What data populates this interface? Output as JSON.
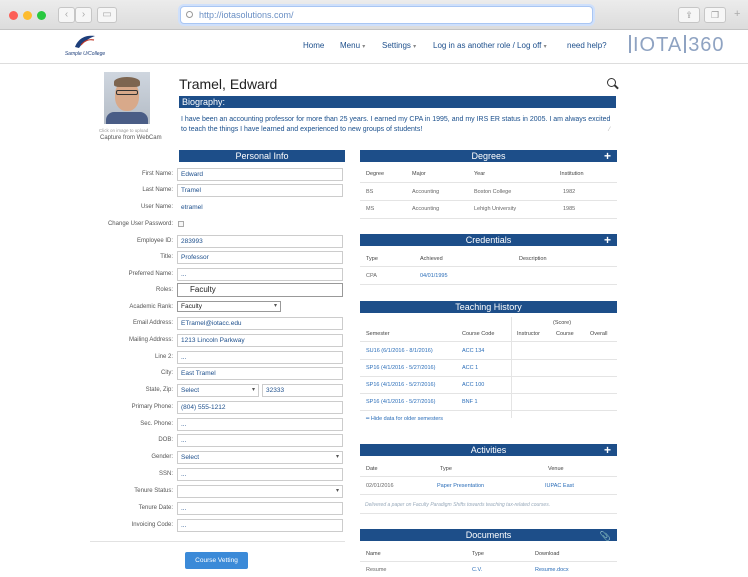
{
  "browser": {
    "url": "http://iotasolutions.com/"
  },
  "header": {
    "logo_text": "Sample U/College",
    "nav": {
      "home": "Home",
      "menu": "Menu",
      "settings": "Settings",
      "login_as": "Log in as another role / Log off",
      "help": "need help?"
    },
    "brand_left": "IOTA",
    "brand_right": "360"
  },
  "profile": {
    "name": "Tramel, Edward",
    "photo_caption": "Click on image to upload",
    "capture": "Capture from WebCam",
    "bio_title": "Biography:",
    "bio_text": "I have been an accounting professor for more than 25 years.  I earned my CPA in 1995, and my IRS ER status in 2005.  I am always excited to teach the things I have learned and experienced to new groups of students!"
  },
  "personal": {
    "title": "Personal Info",
    "fields": {
      "first_name": {
        "label": "First Name:",
        "value": "Edward"
      },
      "last_name": {
        "label": "Last Name:",
        "value": "Tramel"
      },
      "user_name": {
        "label": "User Name:",
        "value": "etramel"
      },
      "change_pw": {
        "label": "Change User Password:"
      },
      "employee_id": {
        "label": "Employee ID:",
        "value": "283993"
      },
      "title": {
        "label": "Title:",
        "value": "Professor"
      },
      "preferred": {
        "label": "Preferred Name:",
        "value": "..."
      },
      "roles": {
        "label": "Roles:",
        "value": "Faculty"
      },
      "rank": {
        "label": "Academic Rank:",
        "value": "Faculty"
      },
      "email": {
        "label": "Email Address:",
        "value": "ETramel@iotacc.edu"
      },
      "mailing": {
        "label": "Mailing Address:",
        "value": "1213 Lincoln Parkway"
      },
      "line2": {
        "label": "Line 2:",
        "value": "..."
      },
      "city": {
        "label": "City:",
        "value": "East Tramel"
      },
      "state_zip": {
        "label": "State, Zip:",
        "state": "Select",
        "zip": "32333"
      },
      "phone": {
        "label": "Primary Phone:",
        "value": "(804) 555-1212"
      },
      "sec_phone": {
        "label": "Sec. Phone:",
        "value": "..."
      },
      "dob": {
        "label": "DOB:",
        "value": "..."
      },
      "gender": {
        "label": "Gender:",
        "value": "Select"
      },
      "ssn": {
        "label": "SSN:",
        "value": "..."
      },
      "tenure_status": {
        "label": "Tenure Status:",
        "value": ""
      },
      "tenure_date": {
        "label": "Tenure Date:",
        "value": "..."
      },
      "invoicing": {
        "label": "Invoicing Code:",
        "value": "..."
      }
    },
    "vetting_button": "Course Vetting"
  },
  "degrees": {
    "title": "Degrees",
    "headers": [
      "Degree",
      "Major",
      "Year",
      "Institution"
    ],
    "rows": [
      [
        "BS",
        "Accounting",
        "Boston College",
        "1982"
      ],
      [
        "MS",
        "Accounting",
        "Lehigh University",
        "1985"
      ]
    ]
  },
  "credentials": {
    "title": "Credentials",
    "headers": [
      "Type",
      "Achieved",
      "Description"
    ],
    "rows": [
      [
        "CPA",
        "04/01/1995",
        ""
      ]
    ]
  },
  "teaching": {
    "title": "Teaching History",
    "score_label": "(Score)",
    "headers": [
      "Semester",
      "Course Code",
      "Instructor",
      "Course",
      "Overall"
    ],
    "rows": [
      [
        "SU16 (6/1/2016 - 8/1/2016)",
        "ACC 134"
      ],
      [
        "SP16 (4/1/2016 - 5/27/2016)",
        "ACC 1"
      ],
      [
        "SP16 (4/1/2016 - 5/27/2016)",
        "ACC 100"
      ],
      [
        "SP16 (4/1/2016 - 5/27/2016)",
        "BNF 1"
      ]
    ],
    "hide_link": "Hide data for older semesters"
  },
  "activities": {
    "title": "Activities",
    "headers": [
      "Date",
      "Type",
      "Venue"
    ],
    "rows": [
      [
        "02/01/2016",
        "Paper Presentation",
        "IUPAC East"
      ]
    ],
    "note": "Delivered a paper on Faculty Paradigm Shifts towards teaching tax-related courses."
  },
  "documents": {
    "title": "Documents",
    "headers": [
      "Name",
      "Type",
      "Download"
    ],
    "rows": [
      [
        "Resume",
        "C.V.",
        "Resume.docx"
      ]
    ]
  },
  "colors": {
    "section_bar": "#1d4e89",
    "link": "#2a6db8",
    "button": "#3b8ad8"
  }
}
